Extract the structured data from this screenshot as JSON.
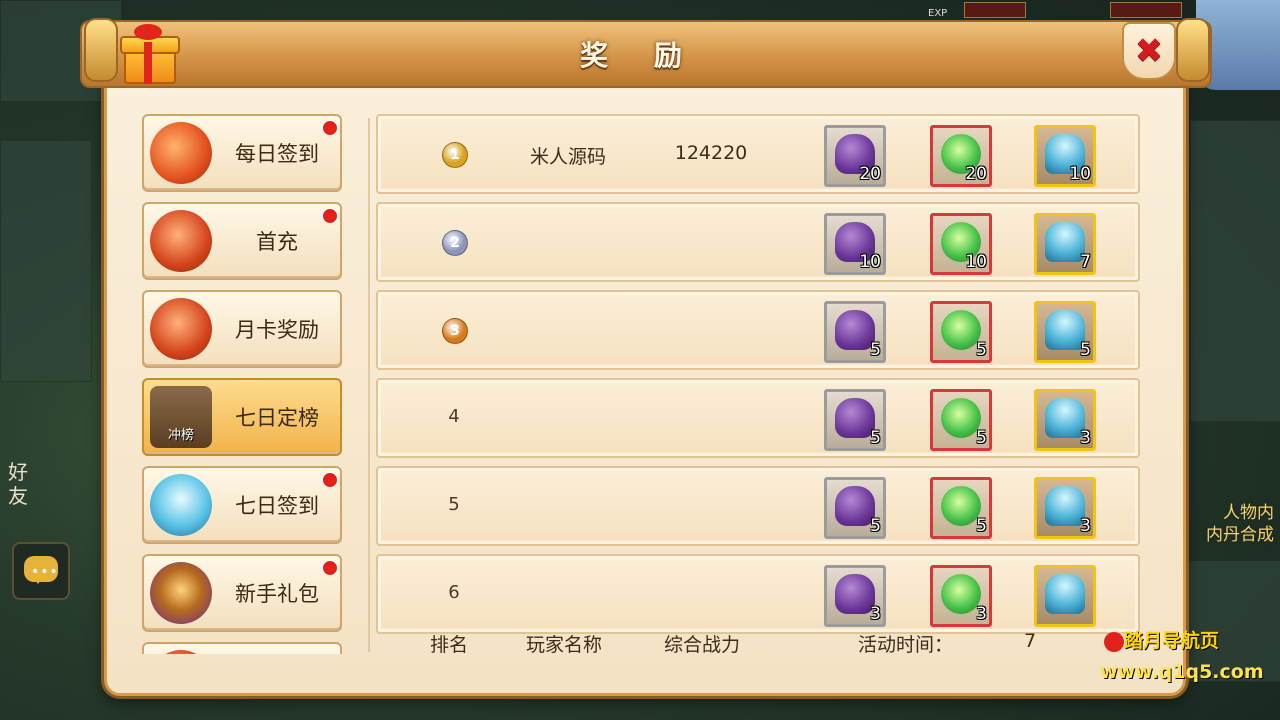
{
  "window": {
    "title": "奖 励"
  },
  "colors": {
    "accent": "#d39b4a",
    "notify": "#e0221a",
    "rank1": "#d9a21f",
    "rank2": "#8c95b8",
    "rank3": "#d77a1c"
  },
  "sidebar": {
    "items": [
      {
        "label": "每日签到",
        "icon": "red-lantern-icon",
        "dot": true,
        "active": false
      },
      {
        "label": "首充",
        "icon": "money-bag-icon",
        "dot": true,
        "active": false
      },
      {
        "label": "月卡奖励",
        "icon": "money-bag-icon",
        "dot": false,
        "active": false
      },
      {
        "label": "七日定榜",
        "icon": "ranking-chest-icon",
        "icon_text": "冲榜",
        "dot": false,
        "active": true
      },
      {
        "label": "七日签到",
        "icon": "blue-pouch-icon",
        "dot": true,
        "active": false
      },
      {
        "label": "新手礼包",
        "icon": "egg-gift-icon",
        "dot": true,
        "active": false
      },
      {
        "label": "",
        "icon": "money-bag-icon",
        "dot": false,
        "active": false
      }
    ]
  },
  "ranking": {
    "rows": [
      {
        "rank": "1",
        "medal": "gold-medal-icon",
        "name": "米人源码",
        "power": "124220",
        "rewards": [
          "20",
          "20",
          "10"
        ]
      },
      {
        "rank": "2",
        "medal": "silver-medal-icon",
        "name": "",
        "power": "",
        "rewards": [
          "10",
          "10",
          "7"
        ]
      },
      {
        "rank": "3",
        "medal": "bronze-medal-icon",
        "name": "",
        "power": "",
        "rewards": [
          "5",
          "5",
          "5"
        ]
      },
      {
        "rank": "4",
        "medal": "",
        "name": "",
        "power": "",
        "rewards": [
          "5",
          "5",
          "3"
        ]
      },
      {
        "rank": "5",
        "medal": "",
        "name": "",
        "power": "",
        "rewards": [
          "5",
          "5",
          "3"
        ]
      },
      {
        "rank": "6",
        "medal": "",
        "name": "",
        "power": "",
        "rewards": [
          "3",
          "3",
          ""
        ]
      }
    ],
    "reward_items": [
      "purple-pouch-icon",
      "green-jade-icon",
      "blue-pouch-icon"
    ],
    "footer": {
      "rank_label": "排名",
      "name_label": "玩家名称",
      "power_label": "综合战力",
      "time_label": "活动时间：",
      "time_value": "7"
    }
  },
  "background": {
    "left_text": "好\n友",
    "right_text_1": "人物内",
    "right_text_2": "内丹合成",
    "exp_label": "EXP",
    "watermark_1": "踏月导航页",
    "watermark_2": "www.q1q5.com"
  }
}
